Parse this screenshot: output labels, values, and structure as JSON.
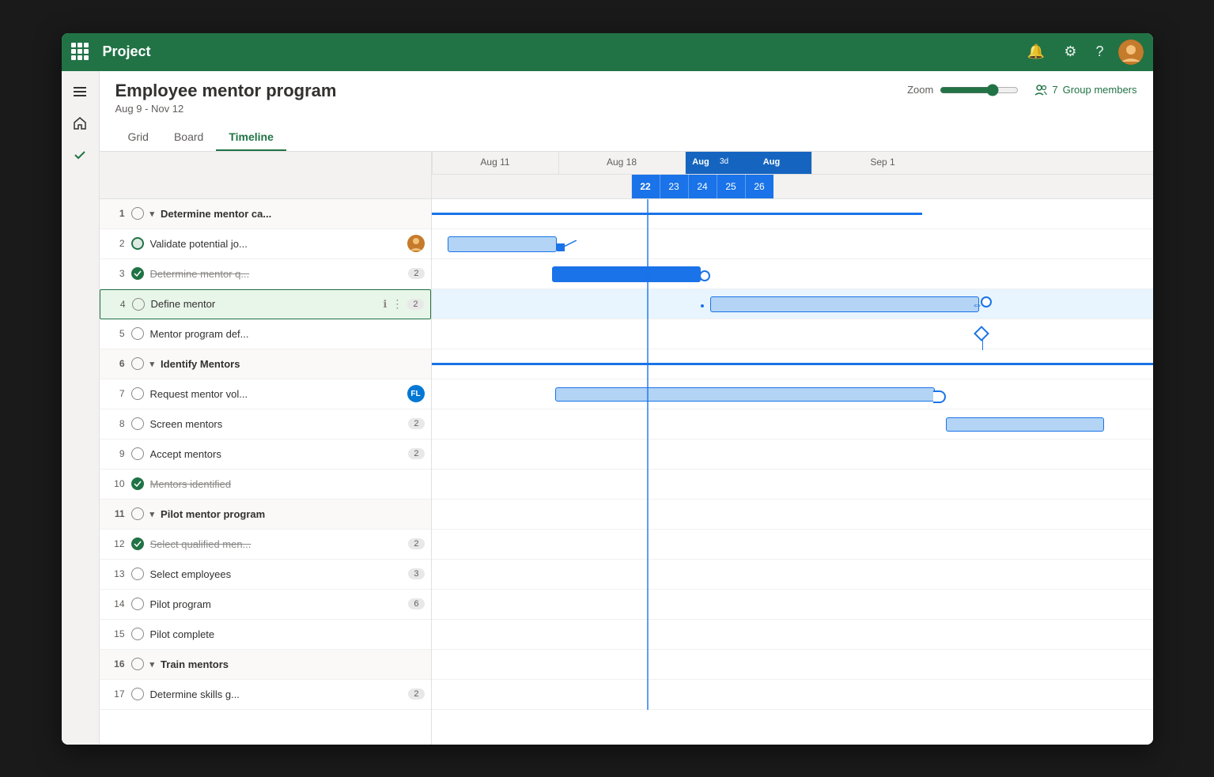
{
  "topBar": {
    "title": "Project",
    "icons": {
      "bell": "🔔",
      "settings": "⚙",
      "help": "?"
    }
  },
  "project": {
    "title": "Employee mentor program",
    "dates": "Aug 9 - Nov 12"
  },
  "tabs": [
    {
      "id": "grid",
      "label": "Grid"
    },
    {
      "id": "board",
      "label": "Board"
    },
    {
      "id": "timeline",
      "label": "Timeline",
      "active": true
    }
  ],
  "zoom": {
    "label": "Zoom"
  },
  "groupMembers": {
    "count": "7",
    "label": "Group members"
  },
  "dateHeaders": {
    "weeks": [
      "Aug 11",
      "Aug 18",
      "Aug 22",
      "Aug 26",
      "Sep 1"
    ],
    "highlightedRange": {
      "start": "22",
      "label3d": "3d"
    },
    "days": [
      "22",
      "23",
      "24",
      "25",
      "26"
    ]
  },
  "tasks": [
    {
      "num": 1,
      "status": "empty",
      "name": "Determine mentor ca...",
      "badge": null,
      "avatar": null,
      "group": true,
      "collapsed": true
    },
    {
      "num": 2,
      "status": "in-progress",
      "name": "Validate potential jo...",
      "badge": null,
      "avatar": "person",
      "group": false
    },
    {
      "num": 3,
      "status": "done",
      "name": "Determine mentor q...",
      "badge": "2",
      "avatar": null,
      "group": false,
      "strikethrough": true
    },
    {
      "num": 4,
      "status": "empty",
      "name": "Define mentor",
      "badge": "2",
      "avatar": null,
      "group": false,
      "selected": true,
      "hasInfo": true,
      "hasMore": true
    },
    {
      "num": 5,
      "status": "empty",
      "name": "Mentor program def...",
      "badge": null,
      "avatar": null,
      "group": false
    },
    {
      "num": 6,
      "status": "empty",
      "name": "Identify Mentors",
      "badge": null,
      "avatar": null,
      "group": true,
      "collapsed": true
    },
    {
      "num": 7,
      "status": "empty",
      "name": "Request mentor vol...",
      "badge": null,
      "avatar": "FL",
      "avatarColor": "#0078d4",
      "group": false
    },
    {
      "num": 8,
      "status": "empty",
      "name": "Screen mentors",
      "badge": "2",
      "avatar": null,
      "group": false
    },
    {
      "num": 9,
      "status": "empty",
      "name": "Accept mentors",
      "badge": "2",
      "avatar": null,
      "group": false
    },
    {
      "num": 10,
      "status": "done",
      "name": "Mentors identified",
      "badge": null,
      "avatar": null,
      "group": false,
      "strikethrough": true
    },
    {
      "num": 11,
      "status": "empty",
      "name": "Pilot mentor program",
      "badge": null,
      "avatar": null,
      "group": true,
      "collapsed": true
    },
    {
      "num": 12,
      "status": "done",
      "name": "Select qualified men...",
      "badge": "2",
      "avatar": null,
      "group": false,
      "strikethrough": true
    },
    {
      "num": 13,
      "status": "empty",
      "name": "Select employees",
      "badge": "3",
      "avatar": null,
      "group": false
    },
    {
      "num": 14,
      "status": "empty",
      "name": "Pilot program",
      "badge": "6",
      "avatar": null,
      "group": false
    },
    {
      "num": 15,
      "status": "empty",
      "name": "Pilot complete",
      "badge": null,
      "avatar": null,
      "group": false
    },
    {
      "num": 16,
      "status": "empty",
      "name": "Train mentors",
      "badge": null,
      "avatar": null,
      "group": true,
      "collapsed": true
    },
    {
      "num": 17,
      "status": "empty",
      "name": "Determine skills g...",
      "badge": "2",
      "avatar": null,
      "group": false
    }
  ],
  "colors": {
    "green": "#217346",
    "blue": "#1a73e8",
    "lightBlue": "#b3d4f5",
    "headerBg": "#f3f2f1"
  }
}
